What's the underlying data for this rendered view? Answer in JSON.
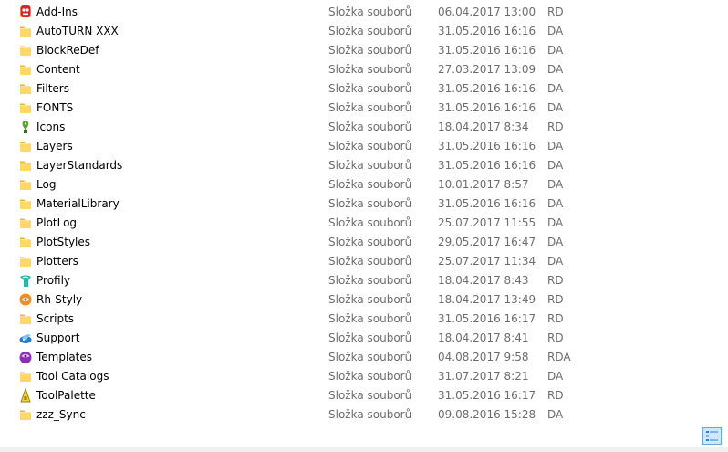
{
  "files": [
    {
      "name": "Add-Ins",
      "type": "Složka souborů",
      "date": "06.04.2017 13:00",
      "attr": "RD",
      "icon": "addins-red-icon"
    },
    {
      "name": "AutoTURN XXX",
      "type": "Složka souborů",
      "date": "31.05.2016 16:16",
      "attr": "DA",
      "icon": "folder-icon"
    },
    {
      "name": "BlockReDef",
      "type": "Složka souborů",
      "date": "31.05.2016 16:16",
      "attr": "DA",
      "icon": "folder-icon"
    },
    {
      "name": "Content",
      "type": "Složka souborů",
      "date": "27.03.2017 13:09",
      "attr": "DA",
      "icon": "folder-icon"
    },
    {
      "name": "Filters",
      "type": "Složka souborů",
      "date": "31.05.2016 16:16",
      "attr": "DA",
      "icon": "folder-icon"
    },
    {
      "name": "FONTS",
      "type": "Složka souborů",
      "date": "31.05.2016 16:16",
      "attr": "DA",
      "icon": "folder-icon"
    },
    {
      "name": "Icons",
      "type": "Složka souborů",
      "date": "18.04.2017 8:34",
      "attr": "RD",
      "icon": "icons-green-icon"
    },
    {
      "name": "Layers",
      "type": "Složka souborů",
      "date": "31.05.2016 16:16",
      "attr": "DA",
      "icon": "folder-icon"
    },
    {
      "name": "LayerStandards",
      "type": "Složka souborů",
      "date": "31.05.2016 16:16",
      "attr": "DA",
      "icon": "folder-icon"
    },
    {
      "name": "Log",
      "type": "Složka souborů",
      "date": "10.01.2017 8:57",
      "attr": "DA",
      "icon": "folder-icon"
    },
    {
      "name": "MaterialLibrary",
      "type": "Složka souborů",
      "date": "31.05.2016 16:16",
      "attr": "DA",
      "icon": "folder-icon"
    },
    {
      "name": "PlotLog",
      "type": "Složka souborů",
      "date": "25.07.2017 11:55",
      "attr": "DA",
      "icon": "folder-icon"
    },
    {
      "name": "PlotStyles",
      "type": "Složka souborů",
      "date": "29.05.2017 16:47",
      "attr": "DA",
      "icon": "folder-icon"
    },
    {
      "name": "Plotters",
      "type": "Složka souborů",
      "date": "25.07.2017 11:34",
      "attr": "DA",
      "icon": "folder-icon"
    },
    {
      "name": "Profily",
      "type": "Složka souborů",
      "date": "18.04.2017 8:43",
      "attr": "RD",
      "icon": "profily-teal-icon"
    },
    {
      "name": "Rh-Styly",
      "type": "Složka souborů",
      "date": "18.04.2017 13:49",
      "attr": "RD",
      "icon": "rhstyly-orange-icon"
    },
    {
      "name": "Scripts",
      "type": "Složka souborů",
      "date": "31.05.2016 16:17",
      "attr": "RD",
      "icon": "folder-icon"
    },
    {
      "name": "Support",
      "type": "Složka souborů",
      "date": "18.04.2017 8:41",
      "attr": "RD",
      "icon": "support-blue-icon"
    },
    {
      "name": "Templates",
      "type": "Složka souborů",
      "date": "04.08.2017 9:58",
      "attr": "RDA",
      "icon": "templates-purple-icon"
    },
    {
      "name": "Tool Catalogs",
      "type": "Složka souborů",
      "date": "31.07.2017 8:21",
      "attr": "DA",
      "icon": "folder-icon"
    },
    {
      "name": "ToolPalette",
      "type": "Složka souborů",
      "date": "31.05.2016 16:17",
      "attr": "RD",
      "icon": "toolpalette-yellow-icon"
    },
    {
      "name": "zzz_Sync",
      "type": "Složka souborů",
      "date": "09.08.2016 15:28",
      "attr": "DA",
      "icon": "folder-icon"
    }
  ],
  "status_bar": {
    "view_toggle_icon": "details-view-icon"
  },
  "colors": {
    "folder": "#ffd867",
    "folder_dark": "#e6b53e",
    "secondary_text": "#6d6d6d",
    "selected_bg": "#cce8ff",
    "selected_border": "#6aa9d9"
  }
}
